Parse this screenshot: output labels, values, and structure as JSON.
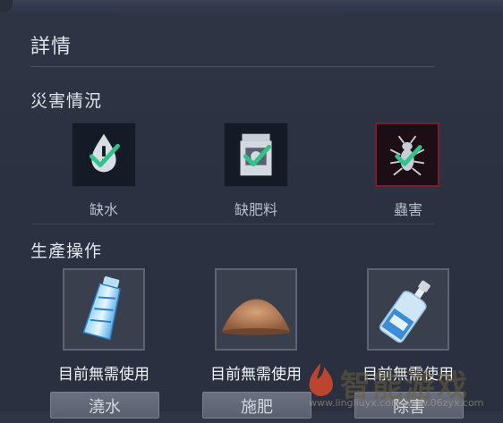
{
  "panel": {
    "title": "詳情"
  },
  "disaster": {
    "title": "災害情況",
    "items": [
      {
        "label": "缺水",
        "icon": "water-drop-warning-icon"
      },
      {
        "label": "缺肥料",
        "icon": "fertilizer-bag-icon"
      },
      {
        "label": "蟲害",
        "icon": "insect-pest-icon"
      }
    ]
  },
  "production": {
    "title": "生產操作",
    "items": [
      {
        "status": "目前無需使用",
        "button": "澆水",
        "icon": "water-bottle-icon"
      },
      {
        "status": "目前無需使用",
        "button": "施肥",
        "icon": "fertilizer-soil-pile-icon"
      },
      {
        "status": "目前無需使用",
        "button": "除害",
        "icon": "pesticide-bottle-icon"
      }
    ]
  },
  "watermark": {
    "text": "智能游戏",
    "url": "www.lingliuyx.com www.06zyx.com"
  },
  "colors": {
    "check": "#2fc28a",
    "pest_border": "#7a1e2b",
    "button_bg": "#626878"
  }
}
